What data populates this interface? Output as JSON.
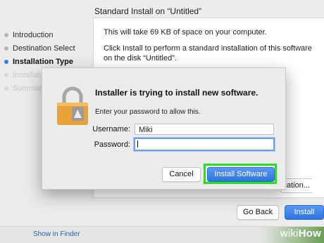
{
  "window": {
    "title": "Standard Install on “Untitled”"
  },
  "sidebar": {
    "steps": [
      {
        "label": "Introduction",
        "state": "done"
      },
      {
        "label": "Destination Select",
        "state": "done"
      },
      {
        "label": "Installation Type",
        "state": "active"
      },
      {
        "label": "Installation",
        "state": "pending"
      },
      {
        "label": "Summary",
        "state": "pending"
      }
    ]
  },
  "content": {
    "space_text": "This will take 69 KB of space on your computer.",
    "install_text_line1": "Click Install to perform a standard installation of this software",
    "install_text_line2": "on the disk “Untitled”.",
    "change_location_label": "Change Install Location..."
  },
  "footer_buttons": {
    "go_back": "Go Back",
    "install": "Install"
  },
  "bottom_strip": {
    "show_in_finder": "Show in Finder",
    "watermark_prefix": "wiki",
    "watermark_suffix": "How"
  },
  "auth_dialog": {
    "title": "Installer is trying to install new software.",
    "description": "Enter your password to allow this.",
    "username_label": "Username:",
    "username_value": "Miki",
    "password_label": "Password:",
    "password_value": "",
    "cancel_label": "Cancel",
    "install_software_label": "Install Software",
    "icon": "lock-icon"
  },
  "colors": {
    "accent": "#3a7ce6",
    "highlight": "#27e21a",
    "lock_body": "#e8a23a"
  }
}
